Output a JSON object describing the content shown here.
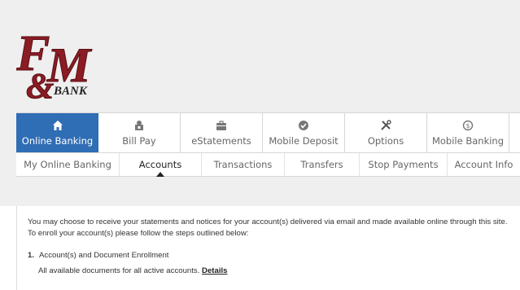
{
  "bank": {
    "name": "F&M BANK",
    "logo_text": "F&M",
    "logo_sub": "BANK",
    "brand_color": "#8b1c24"
  },
  "main_nav": [
    {
      "label": "Online Banking",
      "icon": "home-icon",
      "active": true
    },
    {
      "label": "Bill Pay",
      "icon": "bill-pay-icon",
      "active": false
    },
    {
      "label": "eStatements",
      "icon": "briefcase-icon",
      "active": false
    },
    {
      "label": "Mobile Deposit",
      "icon": "check-circle-icon",
      "active": false
    },
    {
      "label": "Options",
      "icon": "tools-icon",
      "active": false
    },
    {
      "label": "Mobile Banking",
      "icon": "mobile-dollar-icon",
      "active": false
    }
  ],
  "sub_nav": [
    {
      "label": "My Online Banking",
      "active": false
    },
    {
      "label": "Accounts",
      "active": true
    },
    {
      "label": "Transactions",
      "active": false
    },
    {
      "label": "Transfers",
      "active": false
    },
    {
      "label": "Stop Payments",
      "active": false
    },
    {
      "label": "Account Info",
      "active": false
    }
  ],
  "content": {
    "intro": "You may choose to receive your statements and notices for your account(s) delivered via email and made available online through this site. To enroll your account(s) please follow the steps outlined below:",
    "step_number": "1.",
    "step_title": "Account(s) and Document Enrollment",
    "step_desc": "All available documents for all active accounts.",
    "details_link": "Details"
  },
  "colors": {
    "active_tab": "#2f6db5",
    "header_bg": "#efefef"
  }
}
